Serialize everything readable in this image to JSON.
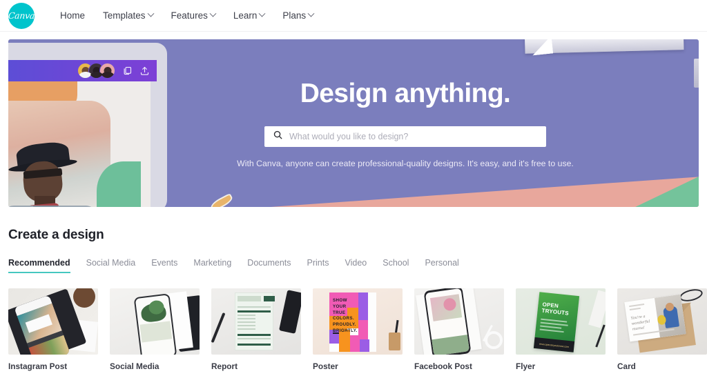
{
  "brand": {
    "name": "Canva",
    "logo_color": "#00c4cc",
    "accent_color": "#45c7c0"
  },
  "nav": {
    "items": [
      {
        "label": "Home",
        "has_caret": false
      },
      {
        "label": "Templates",
        "has_caret": true
      },
      {
        "label": "Features",
        "has_caret": true
      },
      {
        "label": "Learn",
        "has_caret": true
      },
      {
        "label": "Plans",
        "has_caret": true
      }
    ]
  },
  "hero": {
    "background_color": "#7b7ebd",
    "title": "Design anything.",
    "search": {
      "placeholder": "What would you like to design?",
      "value": "",
      "icon": "search-icon"
    },
    "subtitle": "With Canva, anyone can create professional-quality designs. It's easy, and it's free to use.",
    "tablet_toolbar": {
      "avatar_count": 3,
      "icons": [
        "duplicate-icon",
        "upload-icon"
      ]
    }
  },
  "section": {
    "title": "Create a design",
    "tabs": [
      {
        "label": "Recommended",
        "active": true
      },
      {
        "label": "Social Media",
        "active": false
      },
      {
        "label": "Events",
        "active": false
      },
      {
        "label": "Marketing",
        "active": false
      },
      {
        "label": "Documents",
        "active": false
      },
      {
        "label": "Prints",
        "active": false
      },
      {
        "label": "Video",
        "active": false
      },
      {
        "label": "School",
        "active": false
      },
      {
        "label": "Personal",
        "active": false
      }
    ],
    "cards": [
      {
        "label": "Instagram Post"
      },
      {
        "label": "Social Media"
      },
      {
        "label": "Report"
      },
      {
        "label": "Poster"
      },
      {
        "label": "Facebook Post"
      },
      {
        "label": "Flyer"
      },
      {
        "label": "Card"
      }
    ],
    "card_art": {
      "poster_text": "SHOW\nYOUR\nTRUE\nCOLORS.\nPROUDLY.\nBRIGHTLY.",
      "flyer_title": "OPEN\nTRYOUTS",
      "flyer_footer": "www.openstryoutsnow.com",
      "greeting_text": "You're a\nwonderful\nmama!"
    }
  }
}
